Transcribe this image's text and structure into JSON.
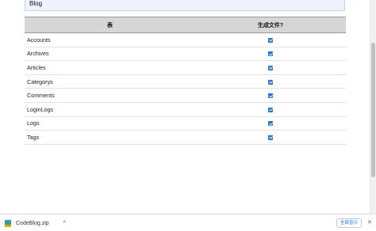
{
  "database": {
    "name": "Blog"
  },
  "table": {
    "headers": [
      "表",
      "生成文件?"
    ],
    "rows": [
      {
        "name": "Accounts",
        "checked": true
      },
      {
        "name": "Archives",
        "checked": true
      },
      {
        "name": "Articles",
        "checked": true
      },
      {
        "name": "Categorys",
        "checked": true
      },
      {
        "name": "Comments",
        "checked": true
      },
      {
        "name": "LoginLogs",
        "checked": true
      },
      {
        "name": "Logs",
        "checked": true
      },
      {
        "name": "Tags",
        "checked": true
      }
    ]
  },
  "downloads": {
    "file_name": "CodeBlog.zip",
    "chevron_glyph": "^",
    "show_all_label": "全部显示",
    "close_glyph": "✕"
  },
  "colors": {
    "checkbox": "#1a73e8",
    "header_bg": "#d6d6d6",
    "db_box_bg": "#eef3fd"
  }
}
